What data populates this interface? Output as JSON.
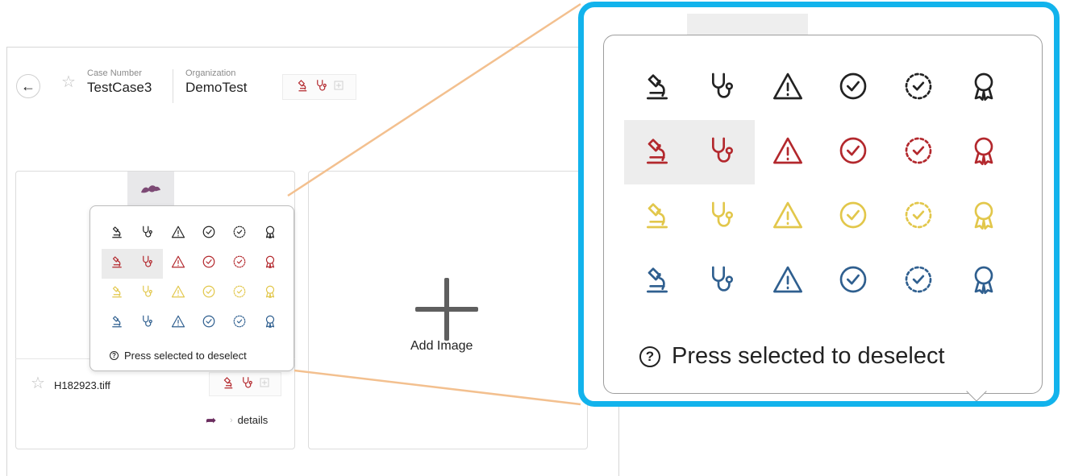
{
  "header": {
    "case_label": "Case Number",
    "case_value": "TestCase3",
    "org_label": "Organization",
    "org_value": "DemoTest"
  },
  "image_card": {
    "file_name": "H182923.tiff",
    "details_label": "details"
  },
  "add_card": {
    "label": "Add Image"
  },
  "tag_picker": {
    "help_text": "Press selected to deselect",
    "icon_types": [
      "microscope-icon",
      "stethoscope-icon",
      "warning-icon",
      "check-circle-icon",
      "dashed-check-circle-icon",
      "award-icon"
    ],
    "color_rows": [
      "#222222",
      "#b3282d",
      "#e2c74b",
      "#2f5f8f"
    ],
    "selected": [
      "red-microscope",
      "red-stethoscope"
    ]
  },
  "colors": {
    "accent_frame": "#12b3ec",
    "connector": "#f3c08f",
    "share": "#6b2d5f"
  }
}
